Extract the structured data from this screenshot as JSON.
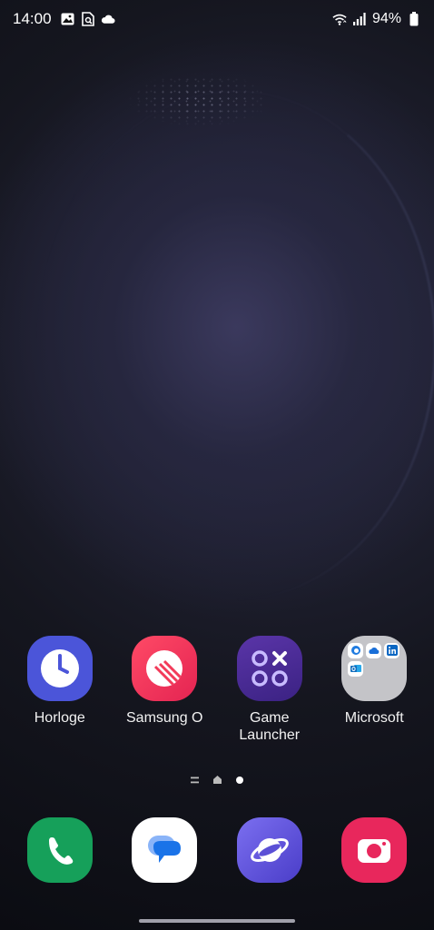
{
  "status_bar": {
    "time": "14:00",
    "battery_text": "94%",
    "left_icons": [
      "gallery-icon",
      "screenshot-search-icon",
      "cloud-icon"
    ],
    "right_icons": [
      "wifi-icon",
      "signal-icon",
      "battery-icon"
    ]
  },
  "home": {
    "apps": [
      {
        "label": "Horloge",
        "icon": "clock-icon",
        "color": "#4b55d9"
      },
      {
        "label": "Samsung O",
        "icon": "samsung-o-icon",
        "color": "#f23b5a"
      },
      {
        "label": "Game\nLauncher",
        "icon": "game-launcher-icon",
        "color": "#4a2c96"
      },
      {
        "label": "Microsoft",
        "icon": "folder-icon",
        "color": "#c4c4c8"
      }
    ],
    "folder_contents": [
      "edge-icon",
      "onedrive-icon",
      "linkedin-icon",
      "outlook-icon"
    ]
  },
  "page_indicator": {
    "items": [
      "menu-page-icon",
      "home-page-icon",
      "current-page-dot"
    ]
  },
  "dock": [
    {
      "icon": "phone-icon",
      "color": "#16a05a"
    },
    {
      "icon": "messages-icon",
      "color": "#ffffff"
    },
    {
      "icon": "internet-icon",
      "color": "#5b50d6"
    },
    {
      "icon": "camera-icon",
      "color": "#e8275c"
    }
  ]
}
